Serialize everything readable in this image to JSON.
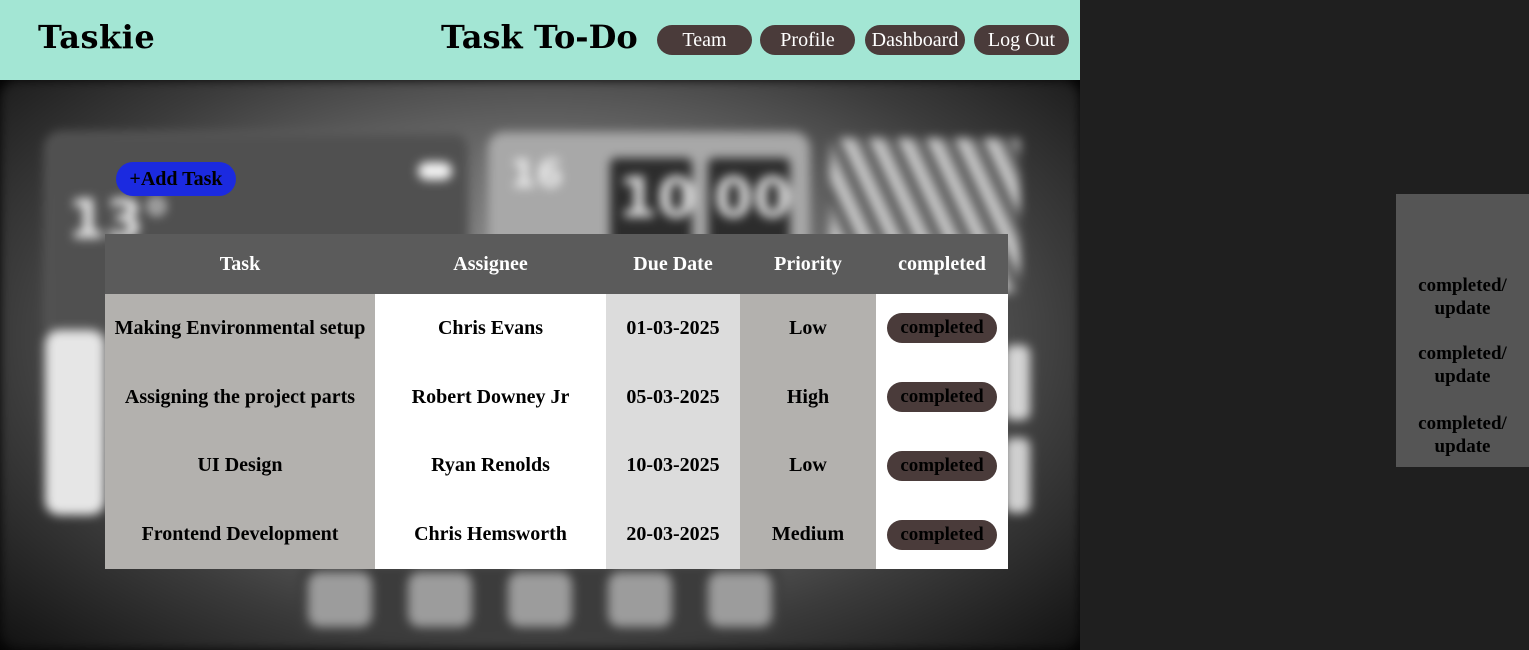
{
  "header": {
    "brand": "Taskie",
    "title": "Task To-Do",
    "nav": [
      "Team",
      "Profile",
      "Dashboard",
      "Log Out"
    ]
  },
  "background_wallpaper": {
    "weather_temp": "13°",
    "clock_date": "16",
    "clock_hours": "10",
    "clock_minutes": "00"
  },
  "actions": {
    "add_task": "+Add Task"
  },
  "table": {
    "headers": [
      "Task",
      "Assignee",
      "Due Date",
      "Priority",
      "completed"
    ],
    "rows": [
      {
        "task": "Making Environmental setup",
        "assignee": "Chris Evans",
        "due": "01-03-2025",
        "priority": "Low",
        "status": "completed"
      },
      {
        "task": "Assigning the project parts",
        "assignee": "Robert Downey Jr",
        "due": "05-03-2025",
        "priority": "High",
        "status": "completed"
      },
      {
        "task": "UI Design",
        "assignee": "Ryan Renolds",
        "due": "10-03-2025",
        "priority": "Low",
        "status": "completed"
      },
      {
        "task": "Frontend Development",
        "assignee": "Chris Hemsworth",
        "due": "20-03-2025",
        "priority": "Medium",
        "status": "completed"
      }
    ]
  },
  "side_panel": {
    "items": [
      "completed/ update",
      "completed/ update",
      "completed/ update"
    ]
  },
  "colors": {
    "header_bg": "#a3e6d4",
    "nav_button": "#4a3b3a",
    "add_button": "#1b2ae0",
    "table_header": "#5b5b5b",
    "side_panel": "#555555"
  }
}
